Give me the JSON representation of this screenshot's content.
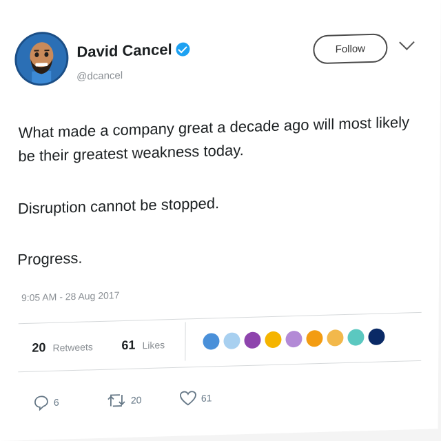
{
  "author": {
    "name": "David Cancel",
    "handle": "@dcancel"
  },
  "follow_label": "Follow",
  "tweet": {
    "line1": "What made a company great a decade ago will most likely",
    "line2": "be their greatest weakness today.",
    "line3": "Disruption cannot be stopped.",
    "line4": "Progress."
  },
  "timestamp": "9:05 AM - 28 Aug 2017",
  "stats": {
    "retweets_count": "20",
    "retweets_label": "Retweets",
    "likes_count": "61",
    "likes_label": "Likes"
  },
  "liker_colors": [
    "#4a90d9",
    "#a8d0f0",
    "#8e44ad",
    "#f5b400",
    "#b38ad6",
    "#f39c12",
    "#f2b84b",
    "#5bc8c0",
    "#0a2a66"
  ],
  "actions": {
    "reply_count": "6",
    "retweet_count": "20",
    "like_count": "61"
  },
  "colors": {
    "verified": "#1da1f2",
    "text": "#1c2022",
    "muted": "#8a8f94"
  }
}
